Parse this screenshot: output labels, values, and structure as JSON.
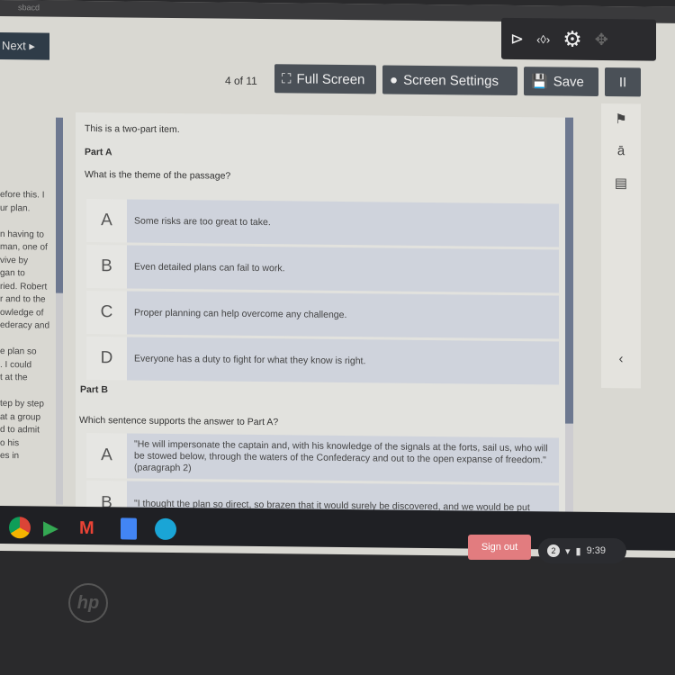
{
  "top_band": {
    "text": "sbacd"
  },
  "nav": {
    "next_label": "Next ▸"
  },
  "toolbar": {
    "page_indicator": "4 of 11",
    "full_screen": "Full Screen",
    "screen_settings": "Screen Settings",
    "save": "Save",
    "pause": "II"
  },
  "passage_fragment": [
    "efore this. I",
    "ur plan.",
    "",
    "n having to",
    "man, one of",
    "vive by",
    "gan to",
    "ried. Robert",
    "r and to the",
    "owledge of",
    "ederacy and",
    "",
    "e plan so",
    ". I could",
    "t at the",
    "",
    "tep by step",
    "at a group",
    "d to admit",
    "o his",
    "es in"
  ],
  "question": {
    "intro": "This is a two-part item.",
    "part_a_label": "Part A",
    "part_a_prompt": "What is the theme of the passage?",
    "part_a_options": [
      {
        "letter": "A",
        "text": "Some risks are too great to take."
      },
      {
        "letter": "B",
        "text": "Even detailed plans can fail to work."
      },
      {
        "letter": "C",
        "text": "Proper planning can help overcome any challenge."
      },
      {
        "letter": "D",
        "text": "Everyone has a duty to fight for what they know is right."
      }
    ],
    "part_b_label": "Part B",
    "part_b_prompt": "Which sentence supports the answer to Part A?",
    "part_b_options": [
      {
        "letter": "A",
        "text": "\"He will impersonate the captain and, with his knowledge of the signals at the forts, sail us, who will be stowed below, through the waters of the Confederacy and out to the open expanse of freedom.\" (paragraph 2)"
      },
      {
        "letter": "B",
        "text": "\"I thought the plan so direct, so brazen that it would surely be discovered, and we would be put"
      }
    ]
  },
  "taskbar": {
    "sign_out": "Sign out",
    "notifications": "2",
    "time": "9:39"
  },
  "brand": "hp"
}
